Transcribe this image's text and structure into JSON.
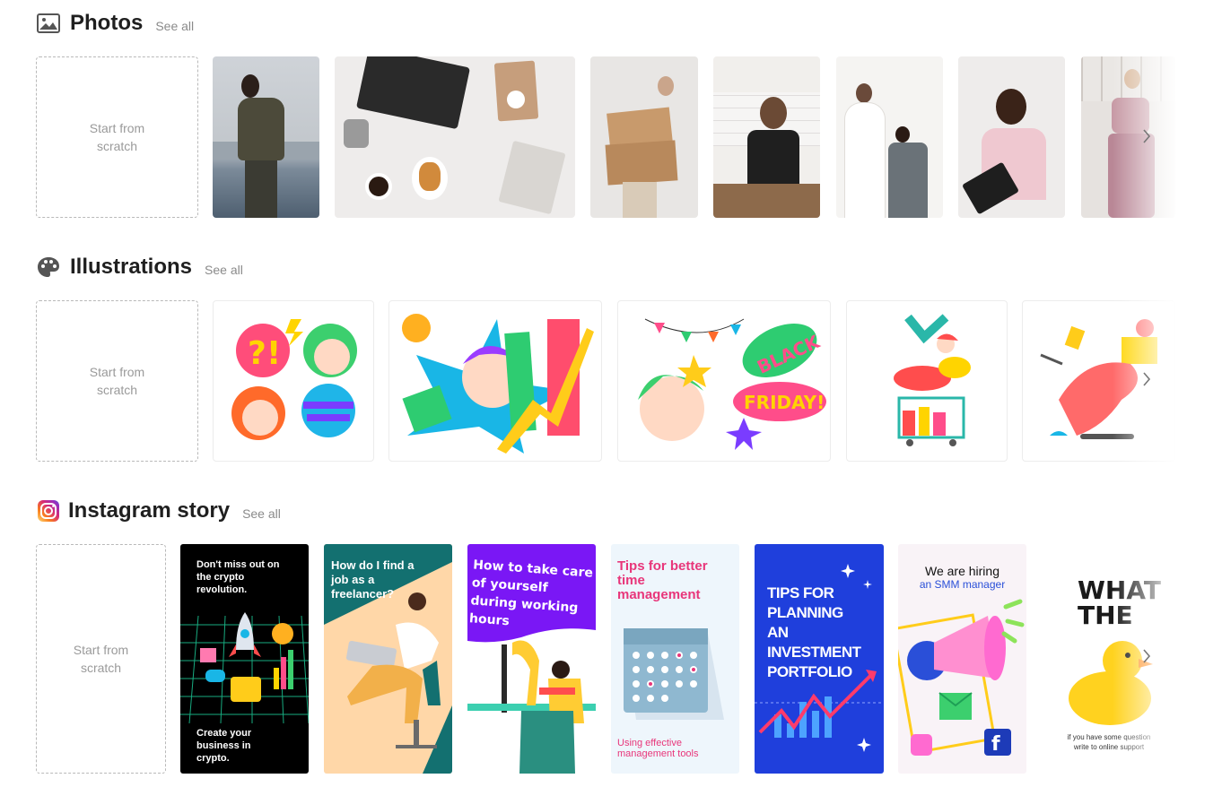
{
  "sections": {
    "photos": {
      "title": "Photos",
      "see_all": "See all",
      "scratch": "Start from scratch"
    },
    "illustrations": {
      "title": "Illustrations",
      "see_all": "See all",
      "scratch": "Start from scratch"
    },
    "instagram": {
      "title": "Instagram story",
      "see_all": "See all",
      "scratch": "Start from scratch"
    }
  },
  "stories": {
    "crypto": {
      "top": "Don't miss out on the crypto revolution.",
      "bottom": "Create your business in crypto."
    },
    "freelancer": {
      "text": "How do I find a job as a freelancer?"
    },
    "care": {
      "text": "How to take care of yourself during working hours"
    },
    "tips_time": {
      "title": "Tips for better time management",
      "sub": "Using effective management tools"
    },
    "investment": {
      "text": "TIPS FOR PLANNING AN INVESTMENT PORTFOLIO"
    },
    "hiring": {
      "line1": "We are hiring",
      "line2": "an SMM manager"
    },
    "duck": {
      "big1": "WHAT",
      "big2": "THE",
      "small": "if you have some question write to online support"
    }
  },
  "icons": {
    "photos": "image-icon",
    "illustrations": "palette-icon",
    "instagram": "instagram-icon",
    "next": "chevron-right-icon"
  },
  "colors": {
    "see_all": "#8a8a8a",
    "dashed_border": "#b9b9b9",
    "instagram_gradient": [
      "#feda75",
      "#fa7e1e",
      "#d62976",
      "#962fbf",
      "#4f5bd5"
    ]
  }
}
